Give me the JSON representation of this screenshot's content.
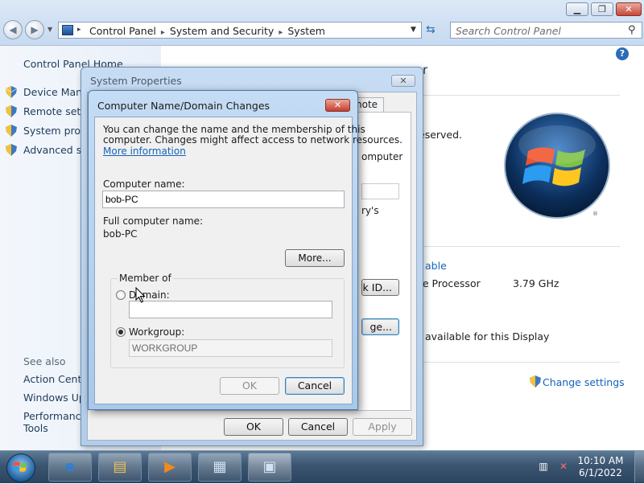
{
  "explorer": {
    "breadcrumb": [
      "Control Panel",
      "System and Security",
      "System"
    ],
    "search_placeholder": "Search Control Panel",
    "left_pane": {
      "home": "Control Panel Home",
      "tasks": [
        "Device Manag",
        "Remote settin",
        "System prote",
        "Advanced sys"
      ],
      "see_also_heading": "See also",
      "see_also": [
        "Action Cente",
        "Windows Upd",
        "Performance",
        "Tools"
      ]
    },
    "right_fragments": {
      "reserved": "eserved.",
      "processor": "re Processor",
      "speed": "3.79 GHz",
      "able": "able",
      "display": "available for this Display",
      "change_settings": "Change settings",
      "r": "r"
    }
  },
  "system_properties": {
    "title": "System Properties",
    "tab_fragment": "note",
    "text_fragments": [
      "omputer",
      "ry's"
    ],
    "button_id_fragment": "k ID...",
    "button_change_fragment": "ge...",
    "buttons": {
      "ok": "OK",
      "cancel": "Cancel",
      "apply": "Apply"
    }
  },
  "computer_name_dialog": {
    "title": "Computer Name/Domain Changes",
    "description_line1": "You can change the name and the membership of this",
    "description_line2": "computer. Changes might affect access to network resources.",
    "more_info_link": "More information",
    "computer_name_label": "Computer name:",
    "computer_name_value": "bob-PC",
    "full_name_label": "Full computer name:",
    "full_name_value": "bob-PC",
    "more_button": "More...",
    "member_of_label": "Member of",
    "domain_label": "Domain:",
    "domain_value": "",
    "workgroup_label": "Workgroup:",
    "workgroup_value": "WORKGROUP",
    "selected": "workgroup",
    "ok_button": "OK",
    "cancel_button": "Cancel"
  },
  "taskbar": {
    "time": "10:10 AM",
    "date": "6/1/2022"
  }
}
